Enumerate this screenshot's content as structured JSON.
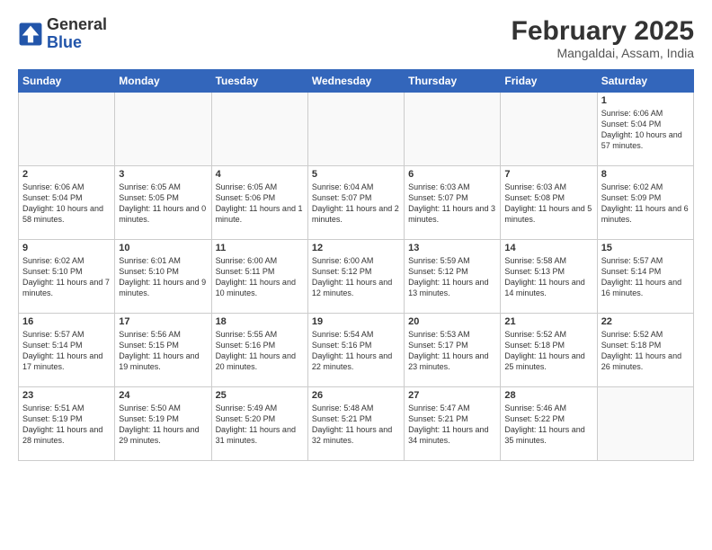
{
  "header": {
    "logo_general": "General",
    "logo_blue": "Blue",
    "month_title": "February 2025",
    "location": "Mangaldai, Assam, India"
  },
  "weekdays": [
    "Sunday",
    "Monday",
    "Tuesday",
    "Wednesday",
    "Thursday",
    "Friday",
    "Saturday"
  ],
  "weeks": [
    [
      {
        "day": "",
        "info": ""
      },
      {
        "day": "",
        "info": ""
      },
      {
        "day": "",
        "info": ""
      },
      {
        "day": "",
        "info": ""
      },
      {
        "day": "",
        "info": ""
      },
      {
        "day": "",
        "info": ""
      },
      {
        "day": "1",
        "info": "Sunrise: 6:06 AM\nSunset: 5:04 PM\nDaylight: 10 hours and 57 minutes."
      }
    ],
    [
      {
        "day": "2",
        "info": "Sunrise: 6:06 AM\nSunset: 5:04 PM\nDaylight: 10 hours and 58 minutes."
      },
      {
        "day": "3",
        "info": "Sunrise: 6:05 AM\nSunset: 5:05 PM\nDaylight: 11 hours and 0 minutes."
      },
      {
        "day": "4",
        "info": "Sunrise: 6:05 AM\nSunset: 5:06 PM\nDaylight: 11 hours and 1 minute."
      },
      {
        "day": "5",
        "info": "Sunrise: 6:04 AM\nSunset: 5:07 PM\nDaylight: 11 hours and 2 minutes."
      },
      {
        "day": "6",
        "info": "Sunrise: 6:03 AM\nSunset: 5:07 PM\nDaylight: 11 hours and 3 minutes."
      },
      {
        "day": "7",
        "info": "Sunrise: 6:03 AM\nSunset: 5:08 PM\nDaylight: 11 hours and 5 minutes."
      },
      {
        "day": "8",
        "info": "Sunrise: 6:02 AM\nSunset: 5:09 PM\nDaylight: 11 hours and 6 minutes."
      }
    ],
    [
      {
        "day": "9",
        "info": "Sunrise: 6:02 AM\nSunset: 5:10 PM\nDaylight: 11 hours and 7 minutes."
      },
      {
        "day": "10",
        "info": "Sunrise: 6:01 AM\nSunset: 5:10 PM\nDaylight: 11 hours and 9 minutes."
      },
      {
        "day": "11",
        "info": "Sunrise: 6:00 AM\nSunset: 5:11 PM\nDaylight: 11 hours and 10 minutes."
      },
      {
        "day": "12",
        "info": "Sunrise: 6:00 AM\nSunset: 5:12 PM\nDaylight: 11 hours and 12 minutes."
      },
      {
        "day": "13",
        "info": "Sunrise: 5:59 AM\nSunset: 5:12 PM\nDaylight: 11 hours and 13 minutes."
      },
      {
        "day": "14",
        "info": "Sunrise: 5:58 AM\nSunset: 5:13 PM\nDaylight: 11 hours and 14 minutes."
      },
      {
        "day": "15",
        "info": "Sunrise: 5:57 AM\nSunset: 5:14 PM\nDaylight: 11 hours and 16 minutes."
      }
    ],
    [
      {
        "day": "16",
        "info": "Sunrise: 5:57 AM\nSunset: 5:14 PM\nDaylight: 11 hours and 17 minutes."
      },
      {
        "day": "17",
        "info": "Sunrise: 5:56 AM\nSunset: 5:15 PM\nDaylight: 11 hours and 19 minutes."
      },
      {
        "day": "18",
        "info": "Sunrise: 5:55 AM\nSunset: 5:16 PM\nDaylight: 11 hours and 20 minutes."
      },
      {
        "day": "19",
        "info": "Sunrise: 5:54 AM\nSunset: 5:16 PM\nDaylight: 11 hours and 22 minutes."
      },
      {
        "day": "20",
        "info": "Sunrise: 5:53 AM\nSunset: 5:17 PM\nDaylight: 11 hours and 23 minutes."
      },
      {
        "day": "21",
        "info": "Sunrise: 5:52 AM\nSunset: 5:18 PM\nDaylight: 11 hours and 25 minutes."
      },
      {
        "day": "22",
        "info": "Sunrise: 5:52 AM\nSunset: 5:18 PM\nDaylight: 11 hours and 26 minutes."
      }
    ],
    [
      {
        "day": "23",
        "info": "Sunrise: 5:51 AM\nSunset: 5:19 PM\nDaylight: 11 hours and 28 minutes."
      },
      {
        "day": "24",
        "info": "Sunrise: 5:50 AM\nSunset: 5:19 PM\nDaylight: 11 hours and 29 minutes."
      },
      {
        "day": "25",
        "info": "Sunrise: 5:49 AM\nSunset: 5:20 PM\nDaylight: 11 hours and 31 minutes."
      },
      {
        "day": "26",
        "info": "Sunrise: 5:48 AM\nSunset: 5:21 PM\nDaylight: 11 hours and 32 minutes."
      },
      {
        "day": "27",
        "info": "Sunrise: 5:47 AM\nSunset: 5:21 PM\nDaylight: 11 hours and 34 minutes."
      },
      {
        "day": "28",
        "info": "Sunrise: 5:46 AM\nSunset: 5:22 PM\nDaylight: 11 hours and 35 minutes."
      },
      {
        "day": "",
        "info": ""
      }
    ]
  ]
}
